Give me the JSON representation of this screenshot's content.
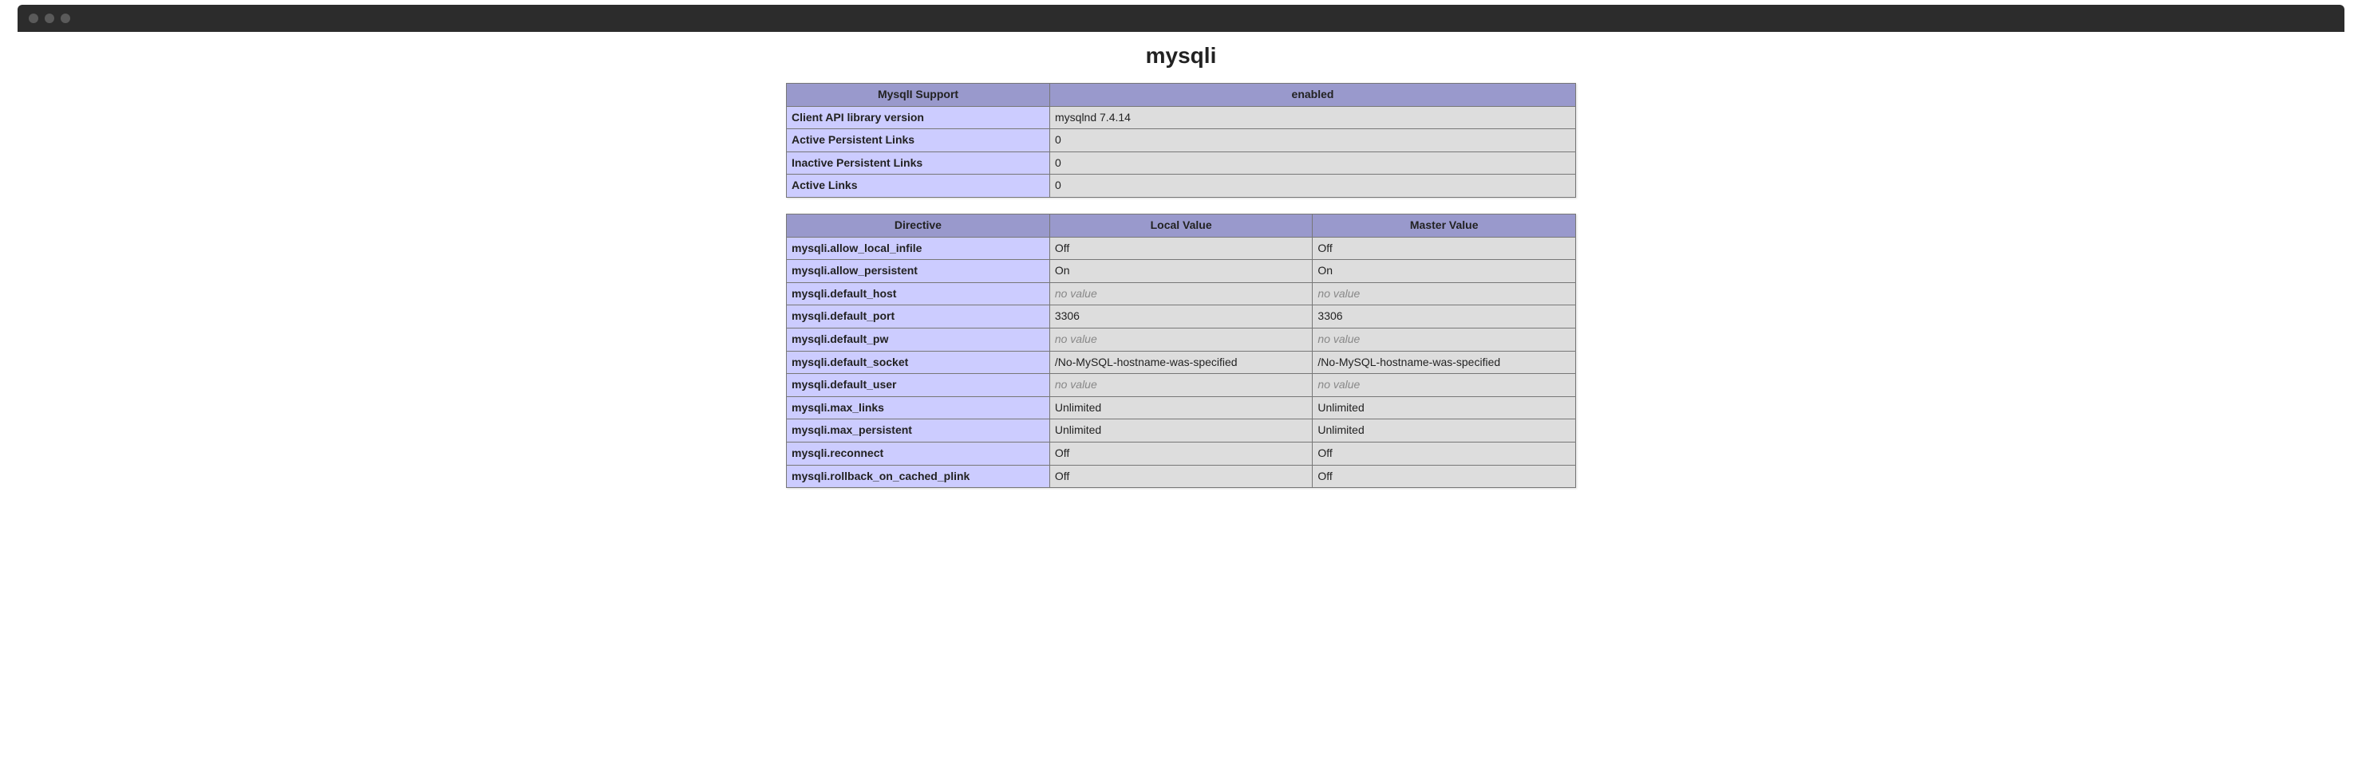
{
  "module_title": "mysqli",
  "summary": {
    "header": {
      "label": "MysqlI Support",
      "value": "enabled"
    },
    "rows": [
      {
        "label": "Client API library version",
        "value": "mysqlnd 7.4.14"
      },
      {
        "label": "Active Persistent Links",
        "value": "0"
      },
      {
        "label": "Inactive Persistent Links",
        "value": "0"
      },
      {
        "label": "Active Links",
        "value": "0"
      }
    ]
  },
  "directives": {
    "headers": {
      "directive": "Directive",
      "local": "Local Value",
      "master": "Master Value"
    },
    "rows": [
      {
        "d": "mysqli.allow_local_infile",
        "l": "Off",
        "m": "Off"
      },
      {
        "d": "mysqli.allow_persistent",
        "l": "On",
        "m": "On"
      },
      {
        "d": "mysqli.default_host",
        "l": null,
        "m": null
      },
      {
        "d": "mysqli.default_port",
        "l": "3306",
        "m": "3306"
      },
      {
        "d": "mysqli.default_pw",
        "l": null,
        "m": null
      },
      {
        "d": "mysqli.default_socket",
        "l": "/No-MySQL-hostname-was-specified",
        "m": "/No-MySQL-hostname-was-specified"
      },
      {
        "d": "mysqli.default_user",
        "l": null,
        "m": null
      },
      {
        "d": "mysqli.max_links",
        "l": "Unlimited",
        "m": "Unlimited"
      },
      {
        "d": "mysqli.max_persistent",
        "l": "Unlimited",
        "m": "Unlimited"
      },
      {
        "d": "mysqli.reconnect",
        "l": "Off",
        "m": "Off"
      },
      {
        "d": "mysqli.rollback_on_cached_plink",
        "l": "Off",
        "m": "Off"
      }
    ],
    "no_value_text": "no value"
  }
}
